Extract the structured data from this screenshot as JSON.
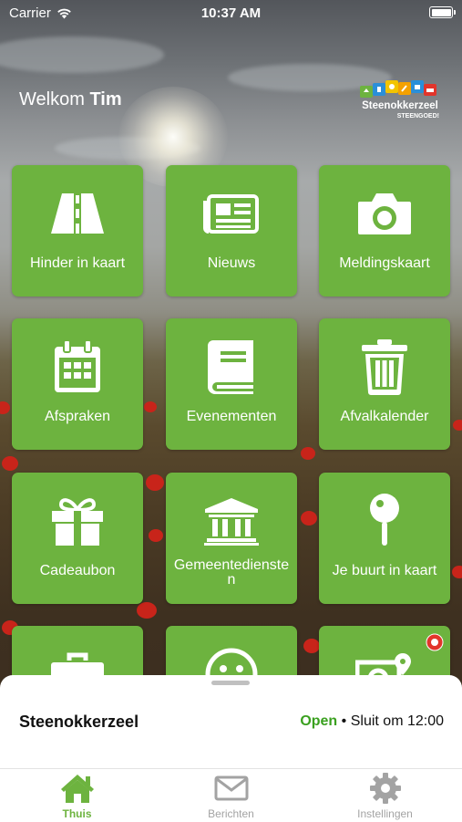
{
  "status_bar": {
    "carrier": "Carrier",
    "time": "10:37 AM"
  },
  "header": {
    "welcome_prefix": "Welkom",
    "user_name": "Tim",
    "logo": {
      "name": "Steenokkerzeel",
      "tagline": "STEENGOED!"
    }
  },
  "tiles": [
    {
      "label": "Hinder in kaart",
      "icon": "road-icon"
    },
    {
      "label": "Nieuws",
      "icon": "newspaper-icon"
    },
    {
      "label": "Meldingskaart",
      "icon": "camera-icon"
    },
    {
      "label": "Afspraken",
      "icon": "calendar-icon"
    },
    {
      "label": "Evenementen",
      "icon": "book-icon"
    },
    {
      "label": "Afvalkalender",
      "icon": "trash-icon"
    },
    {
      "label": "Cadeaubon",
      "icon": "gift-icon"
    },
    {
      "label": "Gemeentediensten",
      "icon": "town-hall-icon"
    },
    {
      "label": "Je buurt in kaart",
      "icon": "map-pin-icon"
    },
    {
      "label": "",
      "icon": "toolbox-icon"
    },
    {
      "label": "",
      "icon": "smiley-icon"
    },
    {
      "label": "",
      "icon": "photo-map-icon"
    }
  ],
  "bottom_sheet": {
    "municipality": "Steenokkerzeel",
    "status": "Open",
    "separator": "•",
    "closing_text": "Sluit om 12:00"
  },
  "tab_bar": [
    {
      "label": "Thuis",
      "icon": "home-icon",
      "active": true
    },
    {
      "label": "Berichten",
      "icon": "mail-icon",
      "active": false
    },
    {
      "label": "Instellingen",
      "icon": "gear-icon",
      "active": false
    }
  ],
  "colors": {
    "tile_green": "#6db33f",
    "open_green": "#3aa01f",
    "tab_inactive": "#a3a3a3"
  }
}
